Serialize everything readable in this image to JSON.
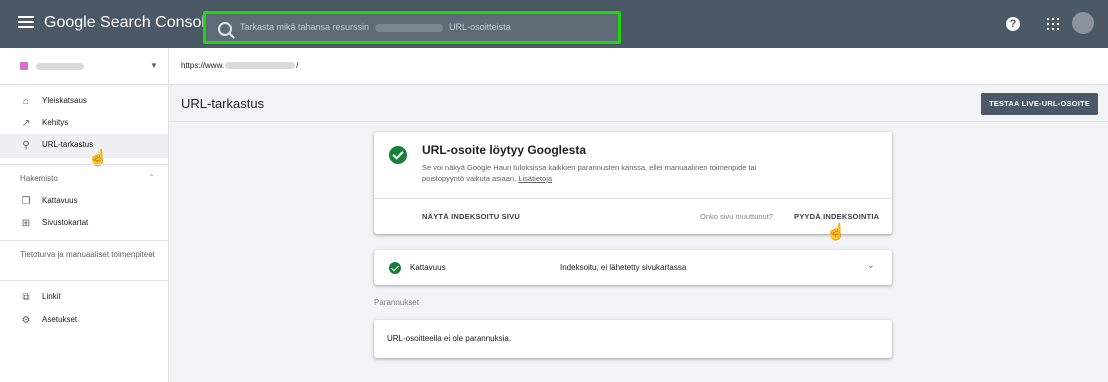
{
  "header": {
    "app_title": "Google Search Console",
    "search_placeholder_pre": "Tarkasta mikä tahansa resurssin",
    "search_placeholder_post": "URL-osoitteista"
  },
  "sidebar": {
    "items_top": [
      {
        "label": "Yleiskatsaus",
        "icon": "home-icon"
      },
      {
        "label": "Kehitys",
        "icon": "trending-up-icon"
      },
      {
        "label": "URL-tarkastus",
        "icon": "search-icon"
      }
    ],
    "section_index": {
      "label": "Hakemisto",
      "items": [
        {
          "label": "Kattavuus",
          "icon": "copy-icon"
        },
        {
          "label": "Sivustokartat",
          "icon": "sitemap-icon"
        }
      ]
    },
    "section_security": {
      "label": "Tietoturva ja manuaaliset toimenpiteet"
    },
    "items_bottom": [
      {
        "label": "Linkit",
        "icon": "links-icon"
      },
      {
        "label": "Asetukset",
        "icon": "gear-icon"
      }
    ]
  },
  "urlbar": {
    "prefix": "https://www.",
    "suffix": "/"
  },
  "page": {
    "title": "URL-tarkastus",
    "live_test_label": "TESTAA LIVE-URL-OSOITE"
  },
  "result": {
    "title": "URL-osoite löytyy Googlesta",
    "description": "Se voi näkyä Google Haun tuloksissa kaikkien parannusten kanssa, ellei manuaalinen toimenpide tai poistopyyntö vaikuta asiaan.",
    "learn_more": "Lisätietoja",
    "view_indexed": "NÄYTÄ INDEKSOITU SIVU",
    "changed_question": "Onko sivu muuttunut?",
    "request_indexing": "PYYDÄ INDEKSOINTIA"
  },
  "coverage": {
    "label": "Kattavuus",
    "status": "Indeksoitu, ei lähetetty sivukartassa"
  },
  "enhancements": {
    "label": "Parannukset",
    "empty_text": "URL-osoitteella ei ole parannuksia."
  },
  "colors": {
    "topbar": "#4b5966",
    "search_highlight": "#20d70c",
    "success": "#188038"
  }
}
